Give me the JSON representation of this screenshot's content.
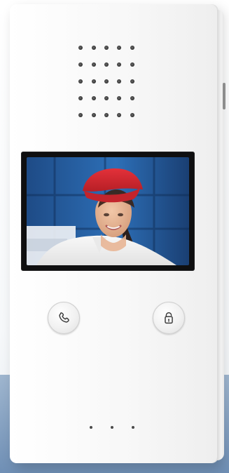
{
  "scene": {
    "background_color": "#f7f8fa",
    "floor_color": "#7f9bbf",
    "device_color": "#f5f5f5"
  },
  "device": {
    "speaker_holes": 25,
    "buttons": [
      {
        "icon": "phone-icon"
      },
      {
        "icon": "padlock-icon"
      }
    ],
    "microphone_holes": 3
  }
}
